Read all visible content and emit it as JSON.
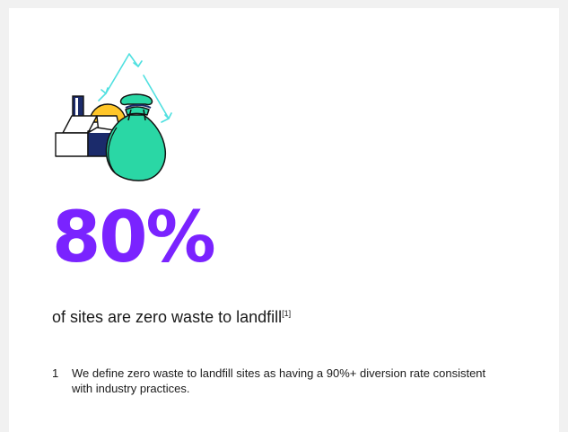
{
  "stat": {
    "value": "80%",
    "caption": "of sites are zero waste to landfill",
    "footnote_ref": "[1]"
  },
  "footnotes": [
    {
      "number": "1",
      "text": "We define zero waste to landfill sites as having a 90%+ diversion rate consistent with industry practices."
    }
  ],
  "colors": {
    "accent_purple": "#7a23ff",
    "bag_green": "#2ad7a5",
    "recycle_cyan": "#4fe0e0",
    "navy": "#1b2b6b",
    "sun_yellow": "#ffc629"
  },
  "icons": {
    "illustration": "waste-bag-recycle-icon"
  }
}
